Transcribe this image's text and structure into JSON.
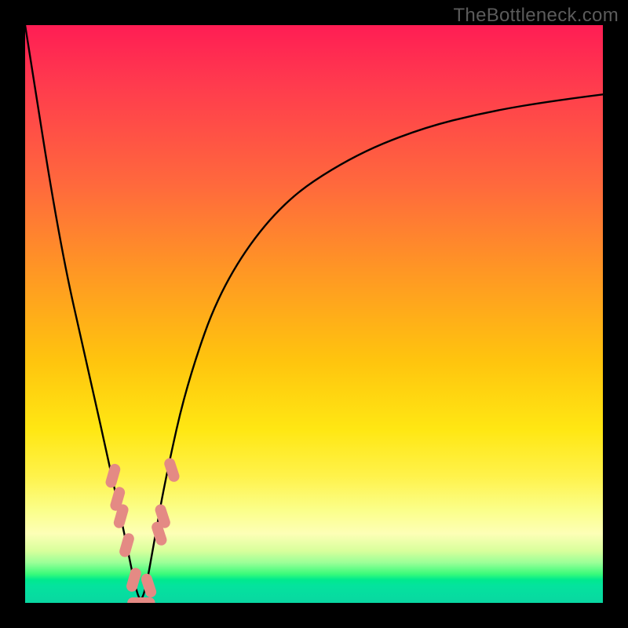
{
  "watermark": "TheBottleneck.com",
  "chart_data": {
    "type": "line",
    "title": "",
    "xlabel": "",
    "ylabel": "",
    "xlim": [
      0,
      5
    ],
    "ylim": [
      0,
      100
    ],
    "background_gradient": {
      "orientation": "vertical",
      "stops": [
        {
          "pct": 0,
          "color": "#ff1d54"
        },
        {
          "pct": 10,
          "color": "#ff3a4e"
        },
        {
          "pct": 28,
          "color": "#ff6a3c"
        },
        {
          "pct": 42,
          "color": "#ff9525"
        },
        {
          "pct": 58,
          "color": "#ffc40e"
        },
        {
          "pct": 70,
          "color": "#ffe713"
        },
        {
          "pct": 78,
          "color": "#fff24a"
        },
        {
          "pct": 84,
          "color": "#fbff8a"
        },
        {
          "pct": 88,
          "color": "#fdffb6"
        },
        {
          "pct": 91,
          "color": "#d8ff9c"
        },
        {
          "pct": 93,
          "color": "#9cff98"
        },
        {
          "pct": 95,
          "color": "#3bfb7a"
        },
        {
          "pct": 96,
          "color": "#00e98e"
        },
        {
          "pct": 97,
          "color": "#04e39e"
        },
        {
          "pct": 100,
          "color": "#09d7a1"
        }
      ]
    },
    "curve": {
      "x": [
        0.0,
        0.3,
        0.55,
        0.75,
        0.88,
        0.95,
        1.0,
        1.05,
        1.12,
        1.22,
        1.4,
        1.7,
        2.2,
        2.8,
        3.4,
        4.0,
        4.6,
        5.0
      ],
      "y": [
        100,
        62,
        40,
        22,
        10,
        3,
        0,
        3,
        11,
        22,
        38,
        55,
        69,
        77,
        82,
        85,
        87,
        88
      ],
      "minimum_x": 1.0,
      "minimum_y": 0
    },
    "markers": [
      {
        "x": 0.76,
        "y": 22
      },
      {
        "x": 0.8,
        "y": 18
      },
      {
        "x": 0.83,
        "y": 15
      },
      {
        "x": 0.88,
        "y": 10
      },
      {
        "x": 0.94,
        "y": 4
      },
      {
        "x": 0.99,
        "y": 0
      },
      {
        "x": 1.02,
        "y": 0
      },
      {
        "x": 1.07,
        "y": 3
      },
      {
        "x": 1.16,
        "y": 12
      },
      {
        "x": 1.19,
        "y": 15
      },
      {
        "x": 1.27,
        "y": 23
      }
    ],
    "colors": {
      "curve": "#000000",
      "marker_fill": "#e48a84",
      "marker_stroke": "#e48a84",
      "frame": "#000000"
    }
  }
}
